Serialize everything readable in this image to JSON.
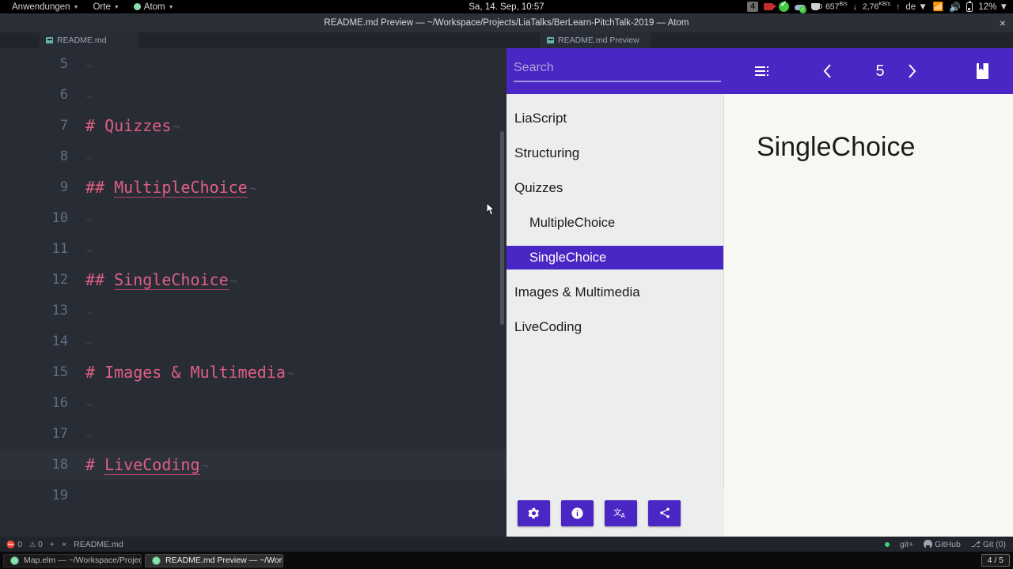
{
  "desktop": {
    "panel": {
      "applications_label": "Anwendungen",
      "places_label": "Orte",
      "atom_label": "Atom",
      "clock": "Sa, 14. Sep, 10:57",
      "tray": {
        "workspace_badge": "4",
        "download_rate": "657",
        "download_rate_unit": "B/s",
        "upload_rate": "2,76",
        "upload_rate_unit": "KB/s",
        "down_arrow": "↓",
        "up_arrow": "↑",
        "keyboard_layout": "de",
        "battery": "12%",
        "camera_icon": "camera-record-icon",
        "check_icon": "check-circle-icon",
        "cloud_icon": "cloud-sync-icon",
        "cup_icon": "coffee-cup-icon",
        "wifi_icon": "wifi-icon",
        "volume_icon": "volume-icon",
        "battery_icon": "battery-icon"
      }
    },
    "taskbar": {
      "items": [
        {
          "label": "Map.elm — ~/Workspace/Projects…",
          "active": false
        },
        {
          "label": "README.md Preview — ~/Worksp…",
          "active": true
        }
      ],
      "workspace_indicator": "4 / 5"
    }
  },
  "atom": {
    "window_title": "README.md Preview — ~/Workspace/Projects/LiaTalks/BerLearn-PitchTalk-2019 — Atom",
    "close_label": "×",
    "editor_tab": {
      "label": "README.md",
      "icon": "markdown-file-icon"
    },
    "preview_tab": {
      "label": "README.md Preview",
      "icon": "markdown-file-icon"
    },
    "code_lines": [
      {
        "num": "5",
        "indent": "",
        "text": "",
        "eol": "¬",
        "cursor": false
      },
      {
        "num": "6",
        "indent": "",
        "text": "",
        "eol": "¬",
        "cursor": false
      },
      {
        "num": "7",
        "indent": "",
        "text": "# Quizzes",
        "eol": "¬",
        "cursor": false,
        "underline": false
      },
      {
        "num": "8",
        "indent": "",
        "text": "",
        "eol": "¬",
        "cursor": false
      },
      {
        "num": "9",
        "indent": "",
        "text": "## MultipleChoice",
        "eol": "¬",
        "cursor": false,
        "underline": true
      },
      {
        "num": "10",
        "indent": "",
        "text": "",
        "eol": "¬",
        "cursor": false
      },
      {
        "num": "11",
        "indent": "",
        "text": "",
        "eol": "¬",
        "cursor": false
      },
      {
        "num": "12",
        "indent": "",
        "text": "## SingleChoice",
        "eol": "¬",
        "cursor": false,
        "underline": true
      },
      {
        "num": "13",
        "indent": "",
        "text": "",
        "eol": "¬",
        "cursor": false
      },
      {
        "num": "14",
        "indent": "",
        "text": "",
        "eol": "¬",
        "cursor": false
      },
      {
        "num": "15",
        "indent": "",
        "text": "# Images & Multimedia",
        "eol": "¬",
        "cursor": false,
        "underline": false
      },
      {
        "num": "16",
        "indent": "",
        "text": "",
        "eol": "¬",
        "cursor": false
      },
      {
        "num": "17",
        "indent": "",
        "text": "",
        "eol": "¬",
        "cursor": false
      },
      {
        "num": "18",
        "indent": "",
        "text": "# LiveCoding",
        "eol": "¬",
        "cursor": true,
        "underline": true
      },
      {
        "num": "19",
        "indent": "",
        "text": "",
        "eol": "",
        "cursor": false
      }
    ],
    "status_bar": {
      "error_count": "0",
      "warning_count": "0",
      "add_label": "+",
      "close_label": "×",
      "file_label": "README.md",
      "git_plus": "git+",
      "github": "GitHub",
      "git_branch": "Git (0)"
    }
  },
  "lia": {
    "search": {
      "placeholder": "Search",
      "value": ""
    },
    "header": {
      "toc_toggle_icon": "toc-list-icon",
      "prev_icon": "chevron-left-icon",
      "next_icon": "chevron-right-icon",
      "slide_number": "5",
      "bookmark_icon": "book-bookmark-icon"
    },
    "toc": [
      {
        "label": "LiaScript",
        "level": 1,
        "active": false
      },
      {
        "label": "Structuring",
        "level": 1,
        "active": false
      },
      {
        "label": "Quizzes",
        "level": 1,
        "active": false
      },
      {
        "label": "MultipleChoice",
        "level": 2,
        "active": false
      },
      {
        "label": "SingleChoice",
        "level": 2,
        "active": true
      },
      {
        "label": "Images & Multimedia",
        "level": 1,
        "active": false
      },
      {
        "label": "LiveCoding",
        "level": 1,
        "active": false
      }
    ],
    "toolbar": [
      {
        "name": "settings",
        "icon": "gear-icon"
      },
      {
        "name": "information",
        "icon": "info-icon"
      },
      {
        "name": "translate",
        "icon": "translate-icon"
      },
      {
        "name": "share",
        "icon": "share-icon"
      }
    ],
    "content": {
      "heading": "SingleChoice"
    }
  },
  "colors": {
    "lia_purple": "#4a26c4",
    "editor_bg": "#282c34",
    "heading_pink": "#e05f84"
  }
}
